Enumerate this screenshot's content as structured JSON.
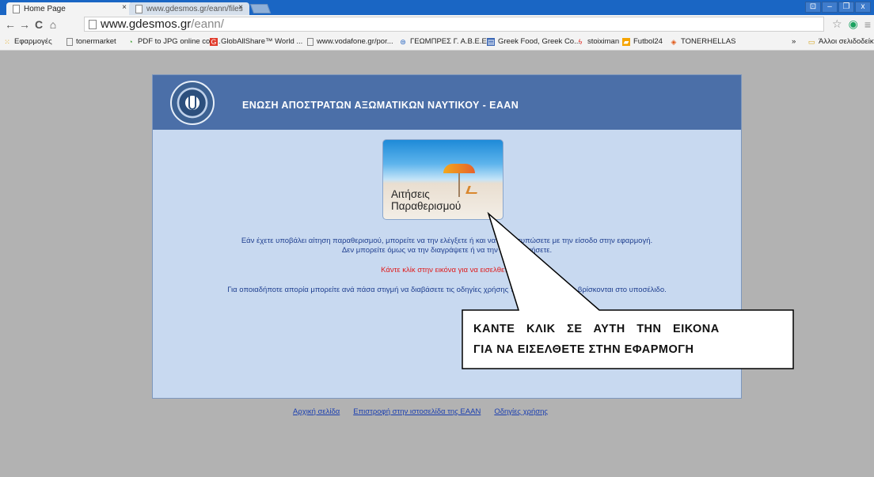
{
  "browser": {
    "tabs": [
      {
        "title": "Home Page",
        "close": "×"
      },
      {
        "title": "www.gdesmos.gr/eann/files",
        "close": "×"
      }
    ],
    "window_controls": [
      "⊡",
      "–",
      "❐",
      "x"
    ],
    "nav": {
      "back": "←",
      "forward": "→",
      "reload": "C",
      "home": "⌂"
    },
    "url": {
      "domain": "www.gdesmos.gr",
      "path": "/eann/"
    },
    "star": "☆",
    "extension": "◉",
    "menu": "≡"
  },
  "bookmarks": {
    "items": [
      {
        "label": "Εφαρμογές",
        "icon": "apps-icon"
      },
      {
        "label": "tonermarket",
        "icon": "page-icon"
      },
      {
        "label": "PDF to JPG online con...",
        "icon": "pdf-icon"
      },
      {
        "label": "GlobAllShare™ World ...",
        "icon": "globallshare-icon"
      },
      {
        "label": "www.vodafone.gr/por...",
        "icon": "page-icon"
      },
      {
        "label": "ΓΕΩΜΠΡΕΣ Γ. Α.Β.Ε.Ε.",
        "icon": "flag-icon"
      },
      {
        "label": "Greek Food, Greek Co...",
        "icon": "food-icon"
      },
      {
        "label": "stoiximan",
        "icon": "stoiximan-icon"
      },
      {
        "label": "Futbol24",
        "icon": "futbol24-icon"
      },
      {
        "label": "TONERHELLAS",
        "icon": "tonerhellas-icon"
      }
    ],
    "overflow": "»",
    "other": "Άλλοι σελιδοδείκτ"
  },
  "page": {
    "title": "ΕΝΩΣΗ ΑΠΟΣΤΡΑΤΩΝ ΑΞΩΜΑΤΙΚΩΝ ΝΑΥΤΙΚΟΥ - ΕΑΑΝ",
    "promo_label_line1": "Αιτήσεις",
    "promo_label_line2": "Παραθερισμού",
    "line1": "Εάν έχετε υποβάλει αίτηση παραθερισμού, μπορείτε να την ελέγξετε ή και να την εκτυπώσετε με την είσοδο στην εφαρμογή.",
    "line2": "Δεν μπορείτε όμως να την διαγράψετε ή να την τροποποιήσετε.",
    "line3": "Κάντε κλίκ στην εικόνα για να εισελθετε.",
    "line4": "Για οποιαδήποτε απορία μπορείτε ανά πάσα στιγμή να διαβάσετε τις οδηγίες χρήσης της εφαρμογής που βρίσκονται στο υποσέλιδο.",
    "footer_links": [
      "Αρχική σελίδα",
      "Επιστροφή στην ιστοσελίδα της ΕΑΑΝ",
      "Οδηγίες χρήσης"
    ]
  },
  "callout": {
    "line1": "ΚΑΝΤΕ ΚΛΙΚ ΣΕ ΑΥΤΗ ΤΗΝ ΕΙΚΟΝΑ",
    "line2": "ΓΙΑ ΝΑ ΕΙΣΕΛΘΕΤΕ ΣΤΗΝ ΕΦΑΡΜΟΓΗ"
  }
}
